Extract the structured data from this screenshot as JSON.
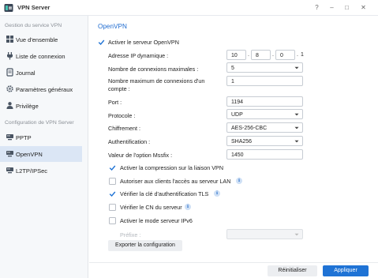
{
  "window": {
    "title": "VPN Server",
    "controls": {
      "help": "?",
      "minimize": "–",
      "maximize": "□",
      "close": "✕"
    }
  },
  "sidebar": {
    "section1": "Gestion du service VPN",
    "items1": [
      {
        "label": "Vue d'ensemble",
        "icon": "overview-icon"
      },
      {
        "label": "Liste de connexion",
        "icon": "plug-icon"
      },
      {
        "label": "Journal",
        "icon": "log-icon"
      },
      {
        "label": "Paramètres généraux",
        "icon": "gear-icon"
      },
      {
        "label": "Privilège",
        "icon": "user-icon"
      }
    ],
    "section2": "Configuration de VPN Server",
    "items2": [
      {
        "label": "PPTP",
        "icon": "network-icon"
      },
      {
        "label": "OpenVPN",
        "icon": "network-icon",
        "active": true
      },
      {
        "label": "L2TP/IPSec",
        "icon": "network-icon"
      }
    ]
  },
  "main": {
    "title": "OpenVPN",
    "enable_label": "Activer le serveur OpenVPN",
    "enable_checked": true,
    "fields": {
      "dynamic_ip": {
        "label": "Adresse IP dynamique :",
        "octets": [
          "10",
          "8",
          "0",
          "1"
        ],
        "dot": "."
      },
      "max_connections": {
        "label": "Nombre de connexions maximales :",
        "value": "5"
      },
      "max_per_account": {
        "label_line1": "Nombre maximum de connexions d'un",
        "label_line2": "compte :",
        "value": "1"
      },
      "port": {
        "label": "Port :",
        "value": "1194"
      },
      "protocol": {
        "label": "Protocole :",
        "value": "UDP"
      },
      "encryption": {
        "label": "Chiffrement :",
        "value": "AES-256-CBC"
      },
      "authentication": {
        "label": "Authentification :",
        "value": "SHA256"
      },
      "mssfix": {
        "label": "Valeur de l'option Mssfix :",
        "value": "1450"
      }
    },
    "options": [
      {
        "label": "Activer la compression sur la liaison VPN",
        "checked": true,
        "info": false
      },
      {
        "label": "Autoriser aux clients l'accès au serveur LAN",
        "checked": false,
        "info": true
      },
      {
        "label": "Vérifier la clé d'authentification TLS",
        "checked": true,
        "info": true
      },
      {
        "label": "Vérifier le CN du serveur",
        "checked": false,
        "info": true
      },
      {
        "label": "Activer le mode serveur IPv6",
        "checked": false,
        "info": false
      }
    ],
    "info_glyph": "i",
    "prefix_label": "Préfixe :",
    "prefix_value": "",
    "export_button": "Exporter la configuration"
  },
  "footer": {
    "reset_button": "Réinitialiser",
    "apply_button": "Appliquer"
  },
  "colors": {
    "accent": "#1f73d5",
    "active_item_bg": "#dbe6f5",
    "title_blue": "#1e6bd0"
  }
}
